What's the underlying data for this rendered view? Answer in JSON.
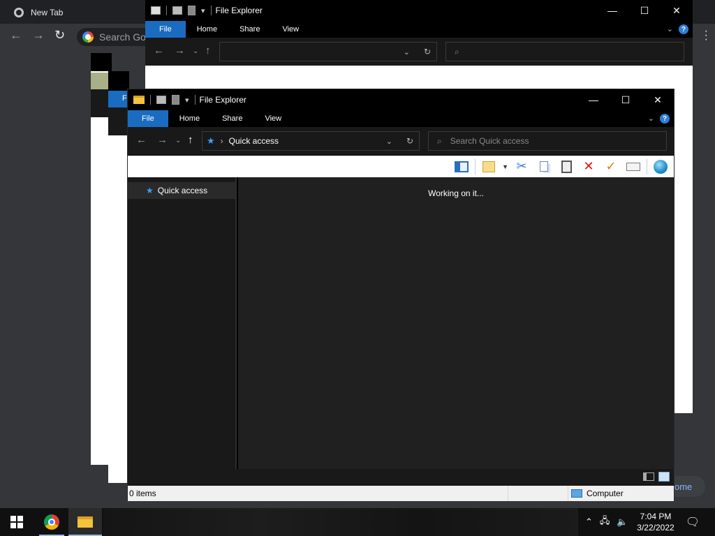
{
  "chrome": {
    "tab_title": "New Tab",
    "search_placeholder": "Search Goo",
    "home_fragment": "ome"
  },
  "explorer_back": {
    "title": "File Explorer",
    "tabs": [
      "File",
      "Home",
      "Share",
      "View"
    ],
    "partial_tab": "F"
  },
  "explorer": {
    "title": "File Explorer",
    "tabs": [
      "File",
      "Home",
      "Share",
      "View"
    ],
    "address": "Quick access",
    "search_placeholder": "Search Quick access",
    "nav_item": "Quick access",
    "content_status": "Working on it...",
    "status_items": "0 items",
    "status_location": "Computer",
    "accent": "#1a6cc0"
  },
  "taskbar": {
    "time": "7:04 PM",
    "date": "3/22/2022"
  }
}
